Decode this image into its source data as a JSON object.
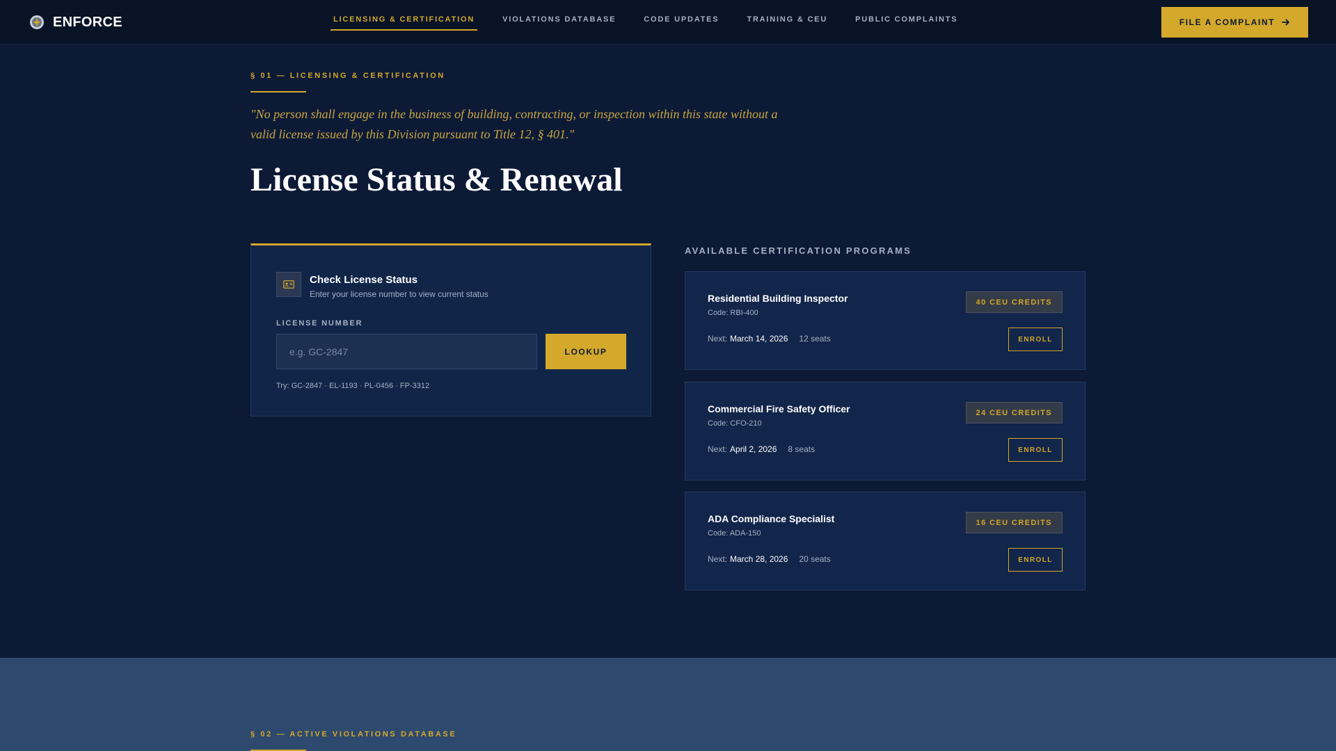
{
  "brand": {
    "name": "ENFORCE",
    "icon": "seal-icon"
  },
  "nav": {
    "items": [
      {
        "label": "LICENSING & CERTIFICATION",
        "active": true
      },
      {
        "label": "VIOLATIONS DATABASE",
        "active": false
      },
      {
        "label": "CODE UPDATES",
        "active": false
      },
      {
        "label": "TRAINING & CEU",
        "active": false
      },
      {
        "label": "PUBLIC COMPLAINTS",
        "active": false
      }
    ],
    "cta_label": "FILE A COMPLAINT",
    "cta_icon": "arrow-right-icon"
  },
  "section1": {
    "label": "§ 01 — LICENSING & CERTIFICATION",
    "quote": "\"No person shall engage in the business of building, contracting, or inspection within this state without a valid license issued by this Division pursuant to Title 12, § 401.\"",
    "title": "License Status & Renewal"
  },
  "license_check": {
    "icon": "id-card-icon",
    "title": "Check License Status",
    "subtitle": "Enter your license number to view current status",
    "field_label": "LICENSE NUMBER",
    "placeholder": "e.g. GC-2847",
    "button_label": "LOOKUP",
    "try_text": "Try: GC-2847 · EL-1193 · PL-0456 · FP-3312"
  },
  "programs": {
    "heading": "AVAILABLE CERTIFICATION PROGRAMS",
    "items": [
      {
        "name": "Residential Building Inspector",
        "code": "Code: RBI-400",
        "credits": "40 CEU CREDITS",
        "next_label": "Next:",
        "next_date": "March 14, 2026",
        "seats": "12 seats",
        "enroll_label": "ENROLL"
      },
      {
        "name": "Commercial Fire Safety Officer",
        "code": "Code: CFO-210",
        "credits": "24 CEU CREDITS",
        "next_label": "Next:",
        "next_date": "April 2, 2026",
        "seats": "8 seats",
        "enroll_label": "ENROLL"
      },
      {
        "name": "ADA Compliance Specialist",
        "code": "Code: ADA-150",
        "credits": "16 CEU CREDITS",
        "next_label": "Next:",
        "next_date": "March 28, 2026",
        "seats": "20 seats",
        "enroll_label": "ENROLL"
      }
    ]
  },
  "section2": {
    "label": "§ 02 — ACTIVE VIOLATIONS DATABASE"
  },
  "colors": {
    "accent": "#d4a82a",
    "background": "#0c1a36",
    "nav_background": "#081326",
    "card": "#112548",
    "section2_background": "#2d4a6e"
  }
}
